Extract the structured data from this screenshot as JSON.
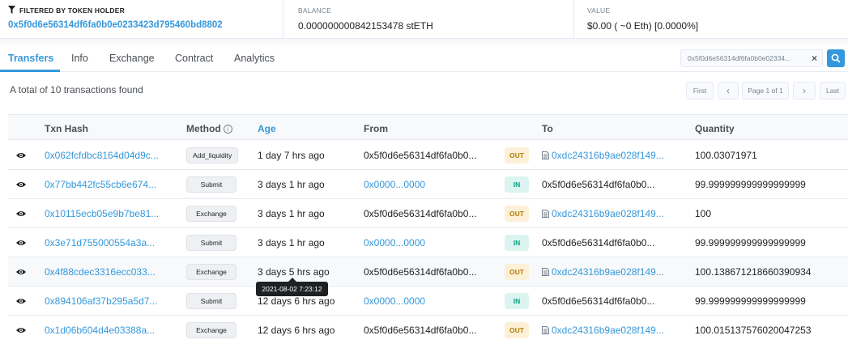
{
  "summary": {
    "filter_label": "FILTERED BY TOKEN HOLDER",
    "filter_address": "0x5f0d6e56314df6fa0b0e0233423d795460bd8802",
    "balance_label": "BALANCE",
    "balance_value": "0.000000000842153478 stETH",
    "value_label": "VALUE",
    "value_value": "$0.00 ( ~0 Eth) [0.0000%]"
  },
  "tabs": [
    "Transfers",
    "Info",
    "Exchange",
    "Contract",
    "Analytics"
  ],
  "search": {
    "value": "0x5f0d6e56314df6fa0b0e02334...",
    "clear": "×"
  },
  "total_text": "A total of 10 transactions found",
  "pagination": {
    "first": "First",
    "prev": "‹",
    "page": "Page 1 of 1",
    "next": "›",
    "last": "Last"
  },
  "table": {
    "headers": {
      "hash": "Txn Hash",
      "method": "Method",
      "age": "Age",
      "from": "From",
      "to": "To",
      "qty": "Quantity"
    },
    "rows": [
      {
        "hash": "0x062fcfdbc8164d04d9c...",
        "method": "Add_liquidity",
        "age": "1 day 7 hrs ago",
        "from": "0x5f0d6e56314df6fa0b0...",
        "dir": "OUT",
        "to": "0xdc24316b9ae028f149...",
        "qty": "100.03071971"
      },
      {
        "hash": "0x77bb442fc55cb6e674...",
        "method": "Submit",
        "age": "3 days 1 hr ago",
        "from": "0x0000...0000",
        "dir": "IN",
        "to": "0x5f0d6e56314df6fa0b0...",
        "qty": "99.999999999999999999"
      },
      {
        "hash": "0x10115ecb05e9b7be81...",
        "method": "Exchange",
        "age": "3 days 1 hr ago",
        "from": "0x5f0d6e56314df6fa0b0...",
        "dir": "OUT",
        "to": "0xdc24316b9ae028f149...",
        "qty": "100"
      },
      {
        "hash": "0x3e71d755000554a3a...",
        "method": "Submit",
        "age": "3 days 1 hr ago",
        "from": "0x0000...0000",
        "dir": "IN",
        "to": "0x5f0d6e56314df6fa0b0...",
        "qty": "99.999999999999999999"
      },
      {
        "hash": "0x4f88cdec3316ecc033...",
        "method": "Exchange",
        "age": "3 days 5 hrs ago",
        "from": "0x5f0d6e56314df6fa0b0...",
        "dir": "OUT",
        "to": "0xdc24316b9ae028f149...",
        "qty": "100.138671218660390934"
      },
      {
        "hash": "0x894106af37b295a5d7...",
        "method": "Submit",
        "age": "12 days 6 hrs ago",
        "from": "0x0000...0000",
        "dir": "IN",
        "to": "0x5f0d6e56314df6fa0b0...",
        "qty": "99.999999999999999999"
      },
      {
        "hash": "0x1d06b604d4e03388a...",
        "method": "Exchange",
        "age": "12 days 6 hrs ago",
        "from": "0x5f0d6e56314df6fa0b0...",
        "dir": "OUT",
        "to": "0xdc24316b9ae028f149...",
        "qty": "100.015137576020047253"
      }
    ]
  },
  "tooltip": "2021-08-02 7:23:12",
  "colors": {
    "accent": "#3498db",
    "out_bg": "#fcf0d8",
    "out_text": "#b47d00",
    "in_bg": "#dcf4ef",
    "in_text": "#00a186"
  }
}
